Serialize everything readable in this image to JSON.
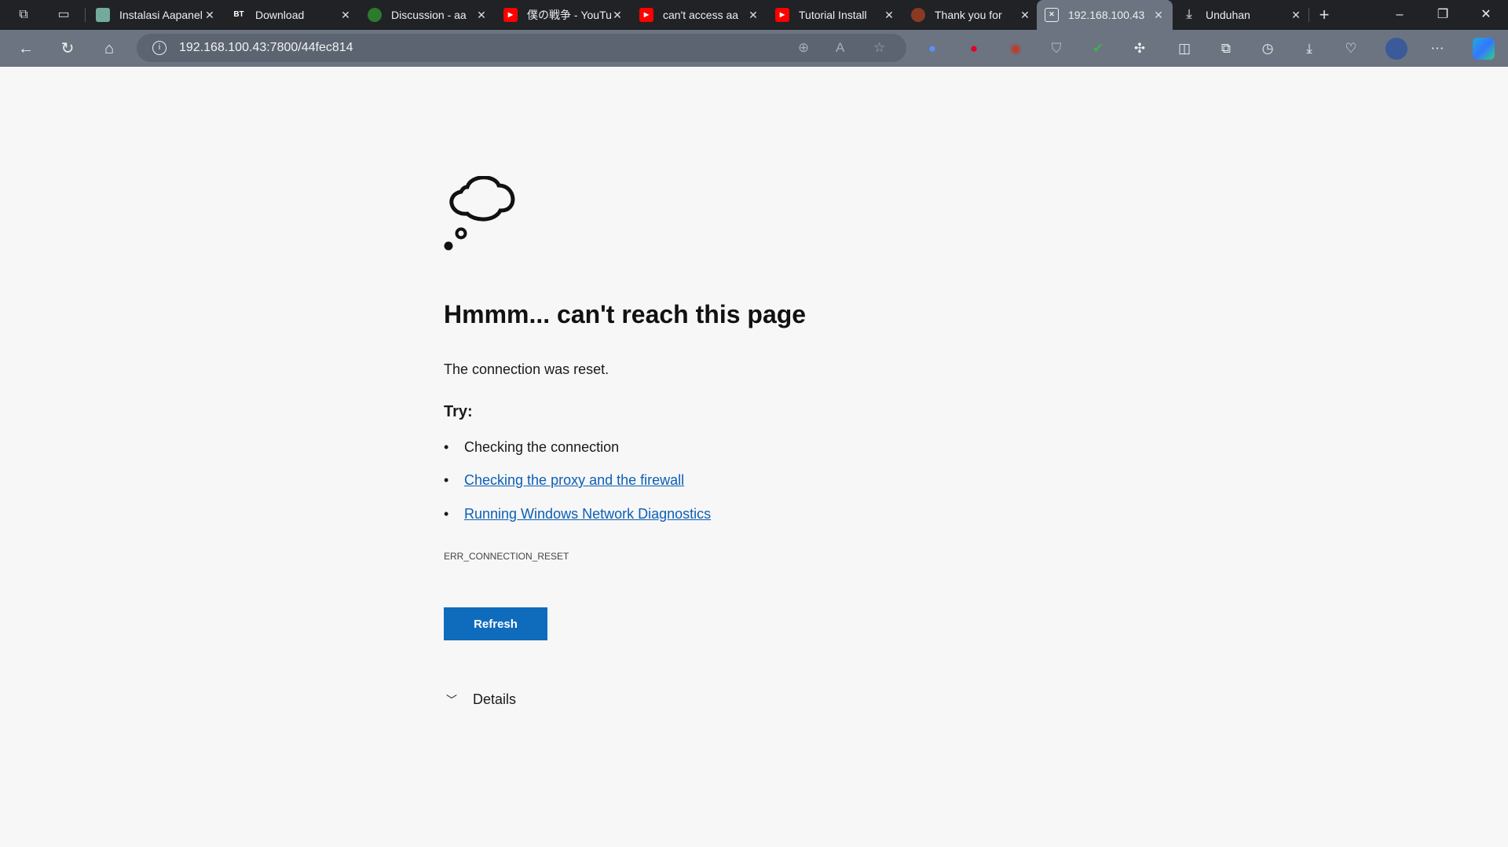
{
  "tabs": [
    {
      "label": "Instalasi Aapanel",
      "favicon": "chatgpt-icon",
      "color": "#74aa9c"
    },
    {
      "label": "Download",
      "favicon": "bt-icon",
      "color": "#222"
    },
    {
      "label": "Discussion - aa",
      "favicon": "discussion-icon",
      "color": "#2c7a2c"
    },
    {
      "label": "僕の戦争 - YouTube",
      "favicon": "youtube-icon",
      "color": "#ff0000"
    },
    {
      "label": "can't access aa",
      "favicon": "youtube-icon",
      "color": "#ff0000"
    },
    {
      "label": "Tutorial Install",
      "favicon": "youtube-icon",
      "color": "#ff0000"
    },
    {
      "label": "Thank you for",
      "favicon": "ubuntu-icon",
      "color": "#8a3a22"
    },
    {
      "label": "192.168.100.43",
      "favicon": "error-page-icon",
      "color": "#6b7480",
      "active": true
    },
    {
      "label": "Unduhan",
      "favicon": "download-icon",
      "color": "#202226"
    }
  ],
  "address": {
    "url": "192.168.100.43:7800/44fec814"
  },
  "page": {
    "title": "Hmmm... can't reach this page",
    "message": "The connection was reset.",
    "try_label": "Try:",
    "suggestions": [
      "Checking the connection",
      "Checking the proxy and the firewall",
      "Running Windows Network Diagnostics"
    ],
    "error_code": "ERR_CONNECTION_RESET",
    "refresh_label": "Refresh",
    "details_label": "Details"
  },
  "colors": {
    "accent": "#0f6cbd",
    "link": "#0c5fb5"
  }
}
